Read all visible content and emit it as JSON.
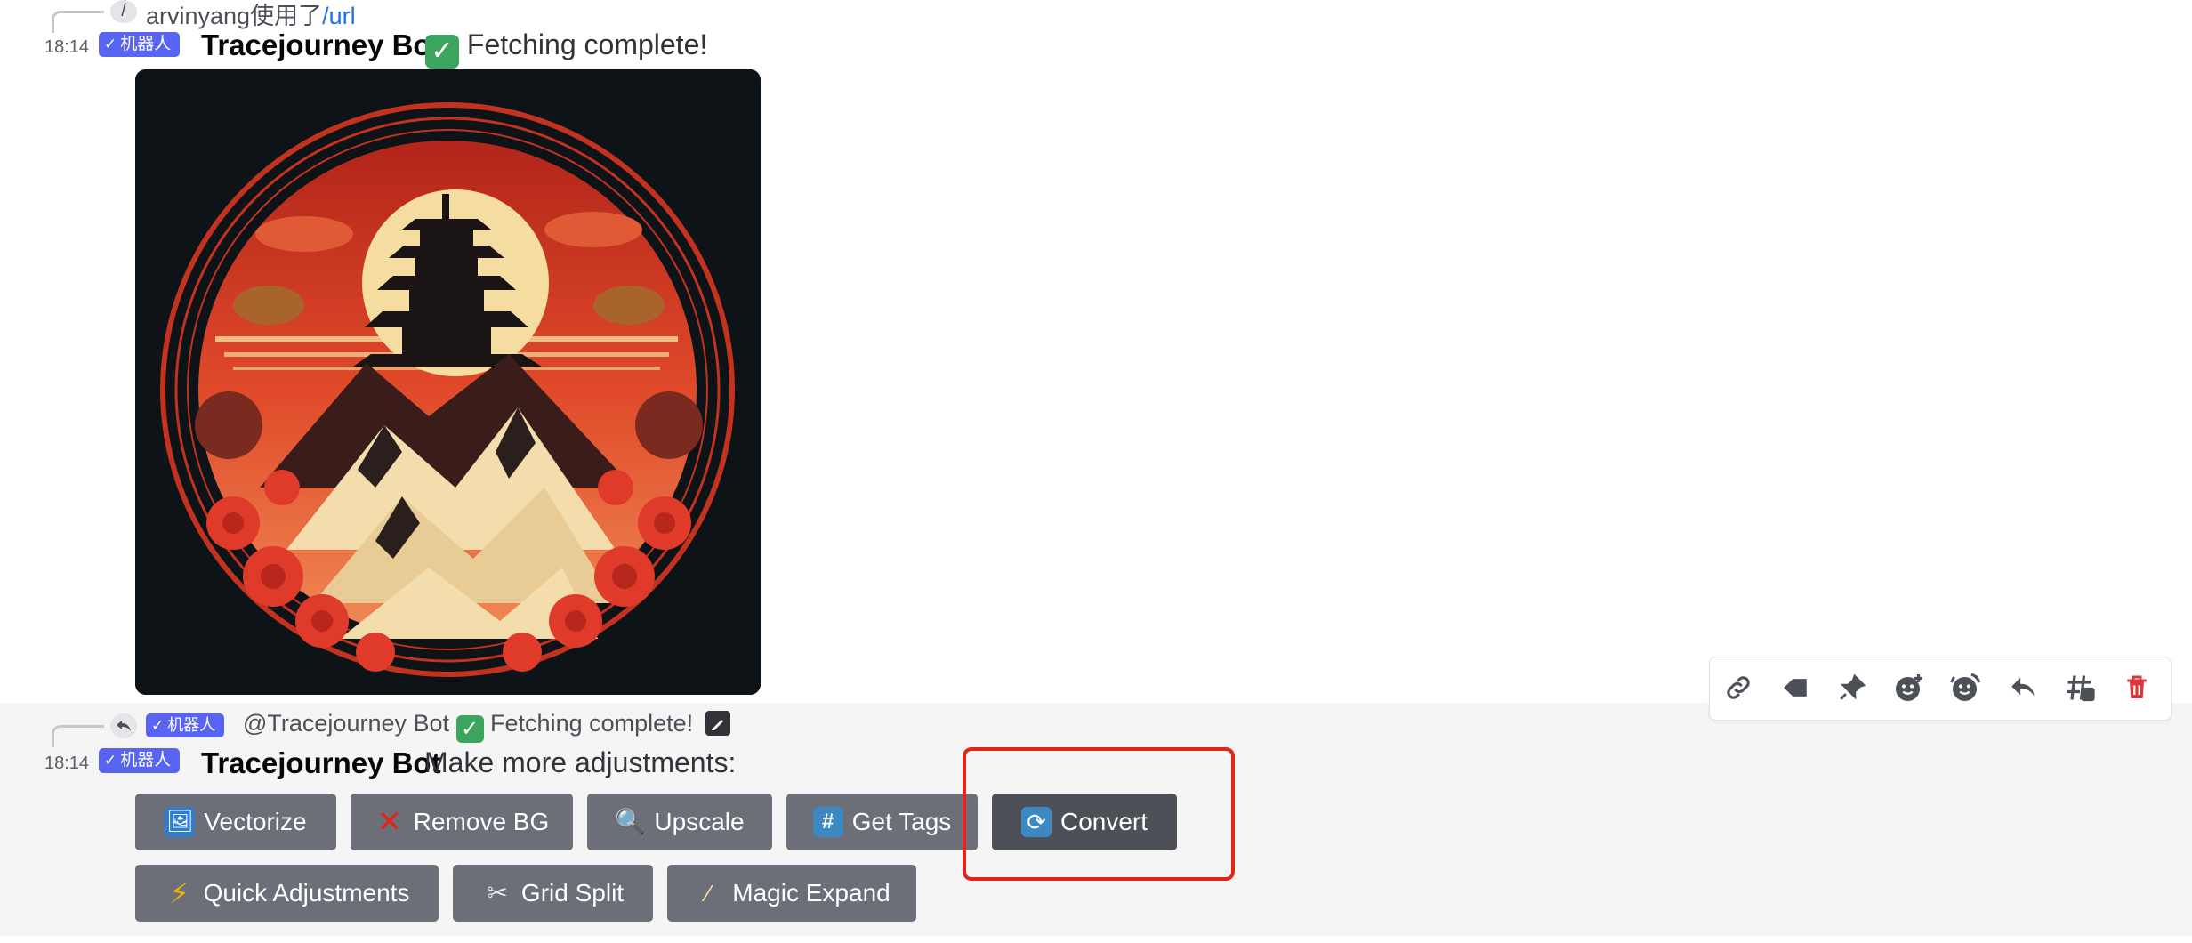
{
  "message1": {
    "reply": {
      "user": "arvinyang",
      "used": "使用了",
      "command": "/url",
      "slash": "/"
    },
    "timestamp": "18:14",
    "bot_tag": "机器人",
    "username": "Tracejourney Bot",
    "content": "Fetching complete!"
  },
  "message2": {
    "reply": {
      "bot_tag": "机器人",
      "mention": "@Tracejourney Bot",
      "content": "Fetching complete!"
    },
    "timestamp": "18:14",
    "bot_tag": "机器人",
    "username": "Tracejourney Bot",
    "content": "Make more adjustments:",
    "buttons_row1": [
      {
        "label": "Vectorize",
        "icon": "framed-picture-icon"
      },
      {
        "label": "Remove BG",
        "icon": "cross-mark-icon"
      },
      {
        "label": "Upscale",
        "icon": "magnifier-icon"
      },
      {
        "label": "Get Tags",
        "icon": "hash-icon"
      },
      {
        "label": "Convert",
        "icon": "arrows-cycle-icon"
      }
    ],
    "buttons_row2": [
      {
        "label": "Quick Adjustments",
        "icon": "lightning-icon"
      },
      {
        "label": "Grid Split",
        "icon": "scissors-icon"
      },
      {
        "label": "Magic Expand",
        "icon": "magic-wand-icon"
      }
    ]
  },
  "toolbar": [
    "link-icon",
    "tag-icon",
    "pin-icon",
    "add-reaction-icon",
    "super-reaction-icon",
    "reply-icon",
    "thread-icon",
    "delete-icon"
  ],
  "colors": {
    "bot_tag": "#5865f2",
    "button": "#6d6f78",
    "button_active": "#4e5058",
    "highlight": "#e0261a",
    "delete": "#da373c"
  }
}
